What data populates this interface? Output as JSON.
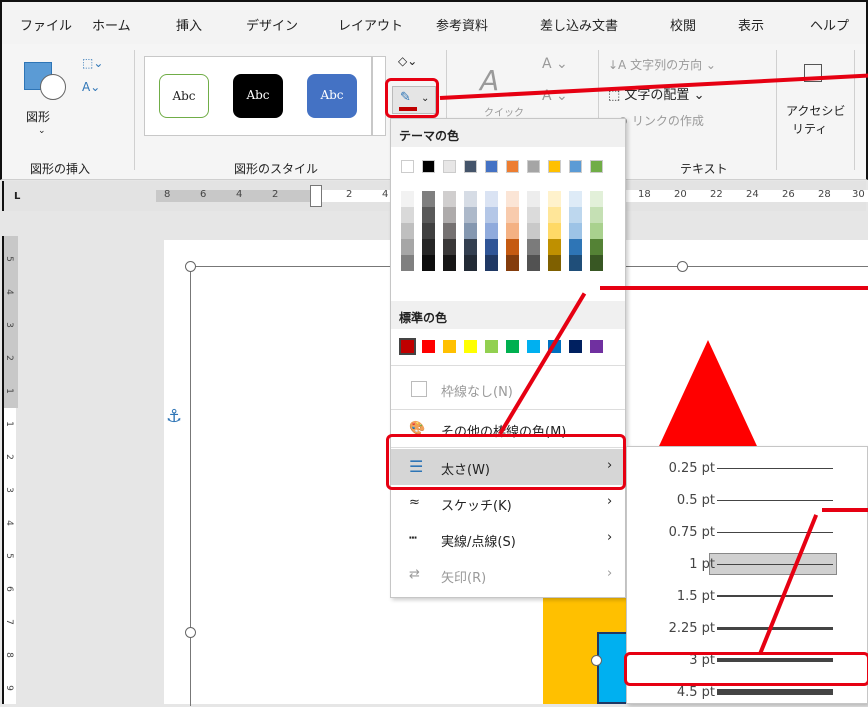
{
  "tabs": [
    "ファイル",
    "ホーム",
    "挿入",
    "デザイン",
    "レイアウト",
    "参考資料",
    "差し込み文書",
    "校閲",
    "表示",
    "ヘルプ"
  ],
  "ribbon": {
    "shape_label": "図形",
    "group_insert": "図形の挿入",
    "style_sample": "Abc",
    "group_styles": "図形のスタイル",
    "text_direction": "文字列の方向",
    "text_align": "文字の配置",
    "create_link": "リンクの作成",
    "group_text": "テキスト",
    "accessibility_1": "アクセシビ",
    "accessibility_2": "リティ",
    "quick_label": "クイック"
  },
  "ruler_h_ticks": [
    "8",
    "6",
    "4",
    "2",
    "2",
    "4",
    "18",
    "20",
    "22",
    "24",
    "26",
    "28",
    "30"
  ],
  "ruler_v_ticks": [
    "5",
    "4",
    "3",
    "2",
    "1",
    "1",
    "2",
    "3",
    "4",
    "5",
    "6",
    "7",
    "8",
    "9"
  ],
  "menu": {
    "theme_colors_heading": "テーマの色",
    "standard_colors_heading": "標準の色",
    "no_outline": "枠線なし(N)",
    "more_colors": "その他の枠線の色(M)...",
    "weight": "太さ(W)",
    "sketch": "スケッチ(K)",
    "dash": "実線/点線(S)",
    "arrows": "矢印(R)"
  },
  "theme_colors": {
    "top": [
      "#ffffff",
      "#000000",
      "#e7e6e6",
      "#44546a",
      "#4472c4",
      "#ed7d31",
      "#a5a5a5",
      "#ffc000",
      "#5b9bd5",
      "#70ad47"
    ],
    "shades": [
      [
        "#f2f2f2",
        "#d9d9d9",
        "#bfbfbf",
        "#a6a6a6",
        "#808080"
      ],
      [
        "#7f7f7f",
        "#595959",
        "#404040",
        "#262626",
        "#0d0d0d"
      ],
      [
        "#d0cece",
        "#aeabab",
        "#757171",
        "#3a3838",
        "#171616"
      ],
      [
        "#d6dce5",
        "#adb9ca",
        "#8497b0",
        "#333f50",
        "#222a35"
      ],
      [
        "#dae3f3",
        "#b4c7e7",
        "#8faadc",
        "#2f5597",
        "#1f3864"
      ],
      [
        "#fbe5d6",
        "#f8cbad",
        "#f4b183",
        "#c55a11",
        "#843c0c"
      ],
      [
        "#ededed",
        "#dbdbdb",
        "#c9c9c9",
        "#7b7b7b",
        "#525252"
      ],
      [
        "#fff2cc",
        "#ffe699",
        "#ffd966",
        "#bf9000",
        "#7f6000"
      ],
      [
        "#deebf7",
        "#bdd7ee",
        "#9dc3e6",
        "#2e75b6",
        "#1f4e79"
      ],
      [
        "#e2f0d9",
        "#c5e0b4",
        "#a9d18e",
        "#548235",
        "#385723"
      ]
    ]
  },
  "standard_colors": [
    "#c00000",
    "#ff0000",
    "#ffc000",
    "#ffff00",
    "#92d050",
    "#00b050",
    "#00b0f0",
    "#0070c0",
    "#002060",
    "#7030a0"
  ],
  "weights": [
    {
      "label": "0.25 pt",
      "pt": 0.25
    },
    {
      "label": "0.5 pt",
      "pt": 0.5
    },
    {
      "label": "0.75 pt",
      "pt": 0.75
    },
    {
      "label": "1 pt",
      "pt": 1
    },
    {
      "label": "1.5 pt",
      "pt": 1.5
    },
    {
      "label": "2.25 pt",
      "pt": 2.25
    },
    {
      "label": "3 pt",
      "pt": 3
    },
    {
      "label": "4.5 pt",
      "pt": 4.5
    }
  ],
  "accent": "#e60012"
}
